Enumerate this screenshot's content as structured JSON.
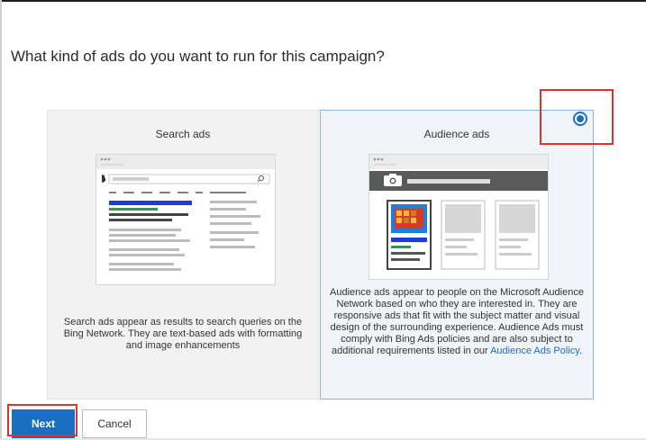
{
  "page": {
    "heading": "What kind of ads do you want to run for this campaign?"
  },
  "options": [
    {
      "title": "Search ads",
      "description": "Search ads appear as results to search queries on the Bing Network. They are text-based ads with formatting and image enhancements",
      "selected": false
    },
    {
      "title": "Audience ads",
      "description": "Audience ads appear to people on the Microsoft Audience Network based on who they are interested in. They are responsive ads that fit with the subject matter and visual design of the surrounding experience. Audience Ads must comply with Bing Ads policies and are also subject to additional requirements listed in our",
      "link": "Audience Ads Policy",
      "link_suffix": ".",
      "selected": true
    }
  ],
  "buttons": {
    "next": "Next",
    "cancel": "Cancel"
  },
  "colors": {
    "accent": "#1a6fc4",
    "highlight": "#e0312b",
    "ad_blue": "#1f3bd6",
    "ad_green": "#1aa34a"
  },
  "icons": {
    "browser_logo": "bing-logo-icon",
    "search": "search-icon",
    "camera": "camera-icon"
  }
}
